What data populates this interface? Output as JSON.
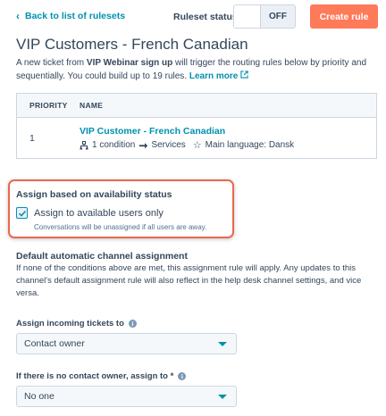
{
  "header": {
    "back_label": "Back to list of rulesets",
    "status_label": "Ruleset status",
    "toggle_state": "OFF",
    "create_label": "Create rule"
  },
  "page": {
    "title": "VIP Customers - French Canadian",
    "desc_part1": "A new ticket from ",
    "desc_bold": "VIP Webinar sign up",
    "desc_part2": " will trigger the routing rules below by priority and sequentially. You could build up to 19 rules. ",
    "learn_more": "Learn more"
  },
  "table": {
    "columns": [
      "PRIORITY",
      "NAME"
    ],
    "rows": [
      {
        "priority": "1",
        "name": "VIP Customer - French Canadian",
        "condition": "1 condition",
        "team": "Services",
        "language": "Main language: Dansk"
      }
    ]
  },
  "availability": {
    "title": "Assign based on availability status",
    "checkbox_label": "Assign to available users only",
    "checked": true,
    "help_text": "Conversations will be unassigned if all users are away."
  },
  "default_assignment": {
    "title": "Default automatic channel assignment",
    "description": "If none of the conditions above are met, this assignment rule will apply. Any updates to this channel's default assignment rule will also reflect in the help desk channel settings, and vice versa."
  },
  "fields": {
    "incoming_label": "Assign incoming tickets to",
    "incoming_value": "Contact owner",
    "no_owner_label": "If there is no contact owner, assign to *",
    "no_owner_value": "No one"
  },
  "colors": {
    "accent": "#0091ae",
    "primary_button": "#ff7a59",
    "highlight_border": "#e8694d",
    "text": "#33475b"
  },
  "icons": {
    "back": "chevron-left-icon",
    "external": "external-link-icon",
    "condition": "hierarchy-icon",
    "arrow": "arrow-right-icon",
    "language": "star-outline-icon",
    "info": "info-icon",
    "caret": "caret-down-icon",
    "check": "checkmark-icon"
  }
}
